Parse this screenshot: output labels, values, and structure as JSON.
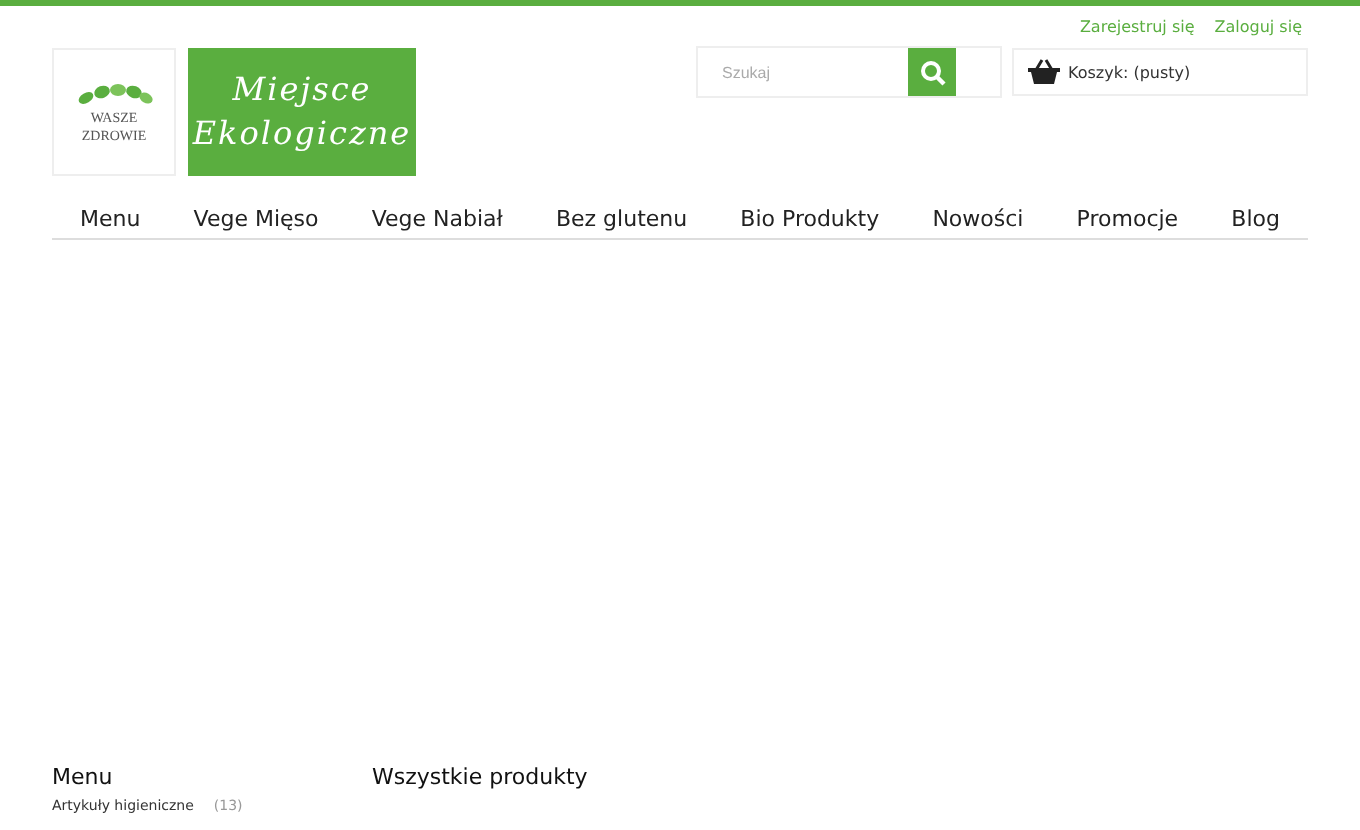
{
  "header_links": [
    "Zarejestruj się",
    "Zaloguj się"
  ],
  "logo": {
    "badge_lines": [
      "WASZE",
      "ZDROWIE"
    ],
    "title_lines": [
      "Miejsce",
      "Ekologiczne"
    ]
  },
  "search": {
    "placeholder": "Szukaj"
  },
  "cart": {
    "label": "Koszyk: (pusty)"
  },
  "nav": [
    "Menu",
    "Vege Mięso",
    "Vege Nabiał",
    "Bez glutenu",
    "Bio Produkty",
    "Nowości",
    "Promocje",
    "Blog"
  ],
  "sidebar": {
    "title": "Menu",
    "items": [
      {
        "label": "Artykuły higieniczne",
        "count": "(13)"
      }
    ]
  },
  "content": {
    "title": "Wszystkie produkty"
  }
}
